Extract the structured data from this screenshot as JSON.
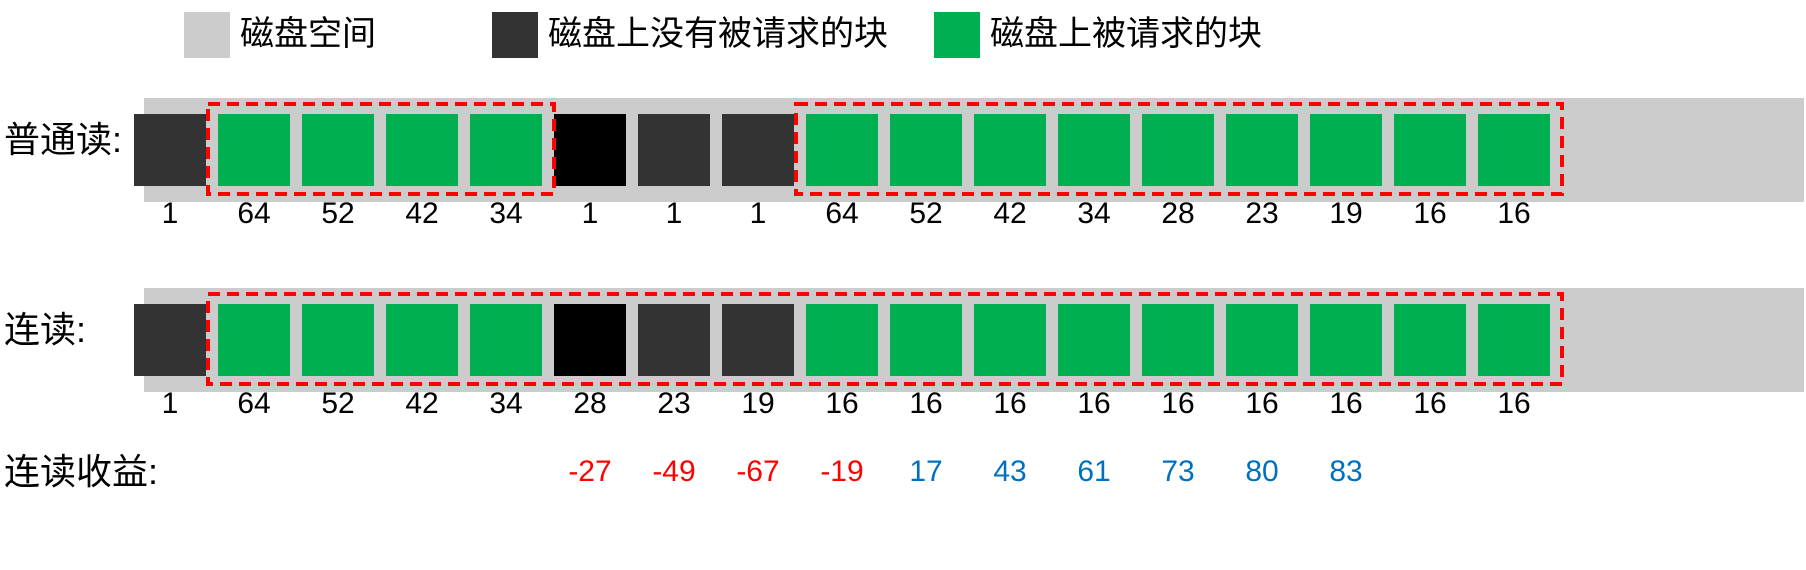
{
  "colors": {
    "disk_space": "#cccccc",
    "unrequested": "#333333",
    "requested": "#00b050",
    "gap_block": "#000000",
    "highlight_border": "#ff0000",
    "gain_negative": "#ff0000",
    "gain_positive": "#0070c0"
  },
  "legend": [
    {
      "label": "磁盘空间",
      "kind": "disk_space"
    },
    {
      "label": "磁盘上没有被请求的块",
      "kind": "unrequested"
    },
    {
      "label": "磁盘上被请求的块",
      "kind": "requested"
    }
  ],
  "rows": [
    {
      "label": "普通读:",
      "blocks": [
        "unrequested",
        "requested",
        "requested",
        "requested",
        "requested",
        "gap_block",
        "unrequested",
        "unrequested",
        "requested",
        "requested",
        "requested",
        "requested",
        "requested",
        "requested",
        "requested",
        "requested",
        "requested"
      ],
      "numbers": [
        "1",
        "64",
        "52",
        "42",
        "34",
        "1",
        "1",
        "1",
        "64",
        "52",
        "42",
        "34",
        "28",
        "23",
        "19",
        "16",
        "16"
      ],
      "groups": [
        [
          1,
          4
        ],
        [
          8,
          16
        ]
      ]
    },
    {
      "label": "连读:",
      "blocks": [
        "unrequested",
        "requested",
        "requested",
        "requested",
        "requested",
        "gap_block",
        "unrequested",
        "unrequested",
        "requested",
        "requested",
        "requested",
        "requested",
        "requested",
        "requested",
        "requested",
        "requested",
        "requested"
      ],
      "numbers": [
        "1",
        "64",
        "52",
        "42",
        "34",
        "28",
        "23",
        "19",
        "16",
        "16",
        "16",
        "16",
        "16",
        "16",
        "16",
        "16",
        "16"
      ],
      "groups": [
        [
          1,
          16
        ]
      ]
    }
  ],
  "gain": {
    "label": "连读收益:",
    "values": [
      {
        "slot": 5,
        "text": "-27",
        "sign": "negative"
      },
      {
        "slot": 6,
        "text": "-49",
        "sign": "negative"
      },
      {
        "slot": 7,
        "text": "-67",
        "sign": "negative"
      },
      {
        "slot": 8,
        "text": "-19",
        "sign": "negative"
      },
      {
        "slot": 9,
        "text": "17",
        "sign": "positive"
      },
      {
        "slot": 10,
        "text": "43",
        "sign": "positive"
      },
      {
        "slot": 11,
        "text": "61",
        "sign": "positive"
      },
      {
        "slot": 12,
        "text": "73",
        "sign": "positive"
      },
      {
        "slot": 13,
        "text": "80",
        "sign": "positive"
      },
      {
        "slot": 14,
        "text": "83",
        "sign": "positive"
      }
    ]
  }
}
